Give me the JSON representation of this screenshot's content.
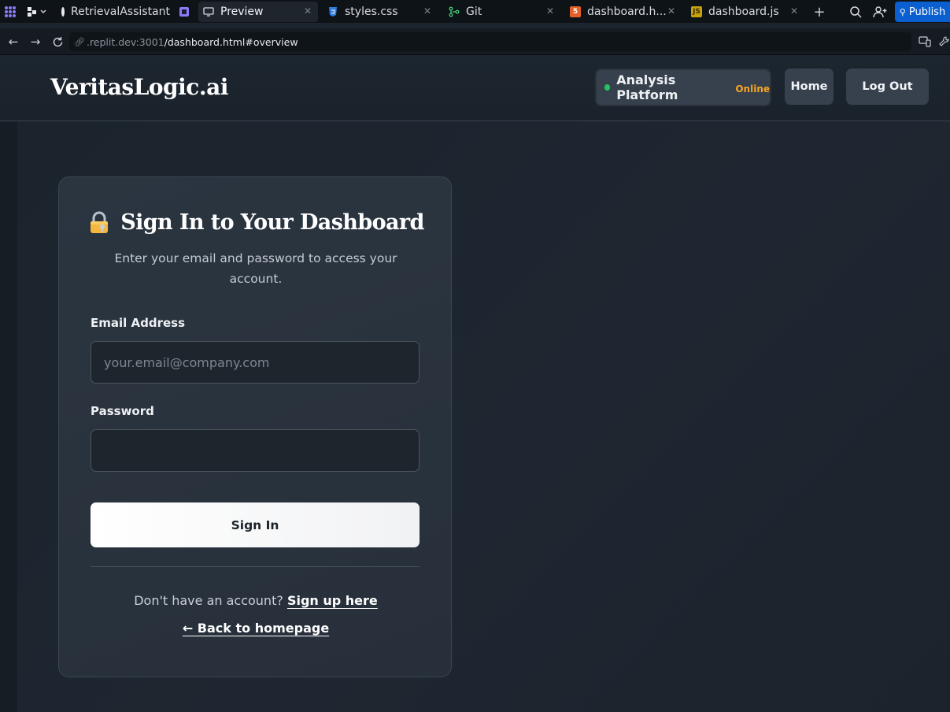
{
  "ide": {
    "tabs": [
      {
        "label": "RetrievalAssistant"
      },
      {
        "label": "Preview"
      },
      {
        "label": "styles.css"
      },
      {
        "label": "Git"
      },
      {
        "label": "dashboard.h..."
      },
      {
        "label": "dashboard.js"
      }
    ],
    "publish_label": "Publish",
    "html_badge": "5",
    "js_badge": "JS"
  },
  "browser": {
    "url_host": ".replit.dev:3001",
    "url_path": "/dashboard.html#overview"
  },
  "header": {
    "brand": "VeritasLogic.ai",
    "platform_label": "Analysis Platform",
    "status": "Online",
    "home_label": "Home",
    "logout_label": "Log Out"
  },
  "login": {
    "title": "Sign In to Your Dashboard",
    "subtitle": "Enter your email and password to access your account.",
    "email_label": "Email Address",
    "email_placeholder": "your.email@company.com",
    "password_label": "Password",
    "signin_label": "Sign In",
    "signup_prompt": "Don't have an account?",
    "signup_link": "Sign up here",
    "back_link": "← Back to homepage"
  },
  "colors": {
    "status_online_dot": "#22c55e",
    "status_text": "#f5a524",
    "publish_blue": "#0b5fd0"
  }
}
